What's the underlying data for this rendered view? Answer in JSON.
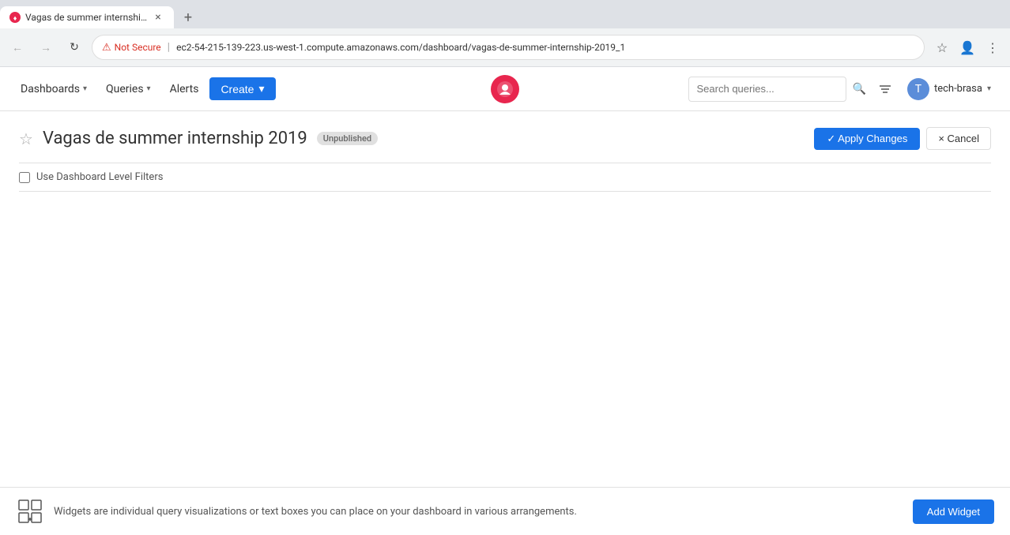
{
  "browser": {
    "tab": {
      "favicon_color": "#e8264e",
      "title": "Vagas de summer internship 2...",
      "close_label": "×",
      "new_tab_label": "+"
    },
    "nav": {
      "back_label": "←",
      "forward_label": "→",
      "reload_label": "↻"
    },
    "address": {
      "not_secure_label": "Not Secure",
      "separator": "|",
      "url": "ec2-54-215-139-223.us-west-1.compute.amazonaws.com/dashboard/vagas-de-summer-internship-2019_1"
    },
    "address_right": {
      "star_label": "☆",
      "profile_label": "👤",
      "menu_label": "⋮"
    }
  },
  "nav": {
    "dashboards_label": "Dashboards",
    "queries_label": "Queries",
    "alerts_label": "Alerts",
    "create_label": "Create",
    "search_placeholder": "Search queries...",
    "user_name": "tech-brasa"
  },
  "dashboard": {
    "star_label": "☆",
    "title": "Vagas de summer internship 2019",
    "badge": "Unpublished",
    "apply_label": "✓ Apply Changes",
    "cancel_label": "× Cancel",
    "filter_label": "Use Dashboard Level Filters"
  },
  "bottom_bar": {
    "text": "Widgets are individual query visualizations or text boxes you can place on your dashboard in various arrangements.",
    "add_widget_label": "Add Widget"
  }
}
